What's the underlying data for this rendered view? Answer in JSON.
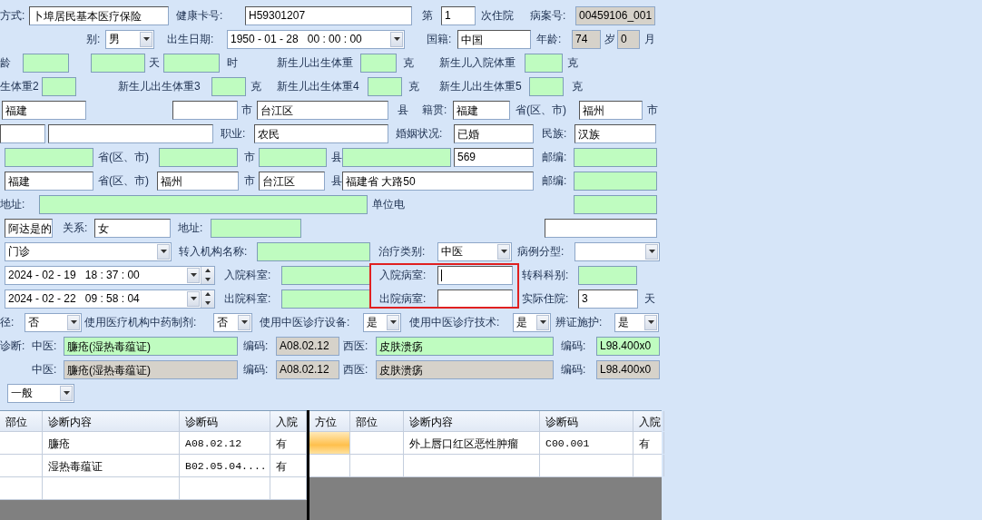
{
  "form_rows": [
    {
      "items": [
        {
          "kind": "label",
          "text": "方式:"
        },
        {
          "kind": "field",
          "value": "卜埠居民基本医疗保险",
          "required": false,
          "readonly": false
        },
        {
          "kind": "label",
          "text": "健康卡号:"
        },
        {
          "kind": "field",
          "value": "H59301207",
          "required": false,
          "readonly": false
        },
        {
          "kind": "label",
          "text": "第"
        },
        {
          "kind": "field",
          "value": "1",
          "required": false,
          "readonly": false
        },
        {
          "kind": "label",
          "text": "次住院"
        },
        {
          "kind": "label",
          "text": "病案号:"
        },
        {
          "kind": "field",
          "value": "00459106_001",
          "required": false,
          "readonly": true
        }
      ]
    },
    {
      "items": [
        {
          "kind": "label",
          "text": "别:"
        },
        {
          "kind": "select",
          "value": "男"
        },
        {
          "kind": "label",
          "text": "出生日期:"
        },
        {
          "kind": "datetime",
          "value": "1950 - 01 - 28   00 : 00 : 00"
        },
        {
          "kind": "label",
          "text": "国籍:"
        },
        {
          "kind": "field",
          "value": "中国",
          "required": false,
          "readonly": false
        },
        {
          "kind": "label",
          "text": "年龄:"
        },
        {
          "kind": "field",
          "value": "74",
          "required": false,
          "readonly": true
        },
        {
          "kind": "label",
          "text": "岁"
        },
        {
          "kind": "field",
          "value": "0",
          "required": false,
          "readonly": true
        },
        {
          "kind": "label",
          "text": "月"
        }
      ]
    },
    {
      "items": [
        {
          "kind": "label",
          "text": "龄"
        },
        {
          "kind": "field",
          "required": true,
          "readonly": false
        },
        {
          "kind": "field",
          "required": true,
          "readonly": false
        },
        {
          "kind": "label",
          "text": "天"
        },
        {
          "kind": "field",
          "required": true,
          "readonly": false
        },
        {
          "kind": "label",
          "text": "时"
        },
        {
          "kind": "label",
          "text": "新生儿出生体重"
        },
        {
          "kind": "field",
          "required": true,
          "readonly": false
        },
        {
          "kind": "label",
          "text": "克"
        },
        {
          "kind": "label",
          "text": "新生儿入院体重"
        },
        {
          "kind": "field",
          "required": true,
          "readonly": false
        },
        {
          "kind": "label",
          "text": "克"
        }
      ]
    },
    {
      "items": [
        {
          "kind": "label",
          "text": "生体重2"
        },
        {
          "kind": "field",
          "required": true,
          "readonly": false
        },
        {
          "kind": "label",
          "text": "新生儿出生体重3"
        },
        {
          "kind": "field",
          "required": true,
          "readonly": false
        },
        {
          "kind": "label",
          "text": "克"
        },
        {
          "kind": "label",
          "text": "新生儿出生体重4"
        },
        {
          "kind": "field",
          "required": true,
          "readonly": false
        },
        {
          "kind": "label",
          "text": "克"
        },
        {
          "kind": "label",
          "text": "新生儿出生体重5"
        },
        {
          "kind": "field",
          "required": true,
          "readonly": false
        },
        {
          "kind": "label",
          "text": "克"
        }
      ]
    },
    {
      "items": [
        {
          "kind": "field",
          "value": "福建",
          "required": false,
          "readonly": false
        },
        {
          "kind": "field",
          "required": false,
          "readonly": false
        },
        {
          "kind": "label",
          "text": "市"
        },
        {
          "kind": "field",
          "value": "台江区",
          "required": false,
          "readonly": false
        },
        {
          "kind": "label",
          "text": "县"
        },
        {
          "kind": "label",
          "text": "籍贯:"
        },
        {
          "kind": "field",
          "value": "福建",
          "required": false,
          "readonly": false
        },
        {
          "kind": "label",
          "text": "省(区、市)"
        },
        {
          "kind": "field",
          "value": "福州",
          "required": false,
          "readonly": false
        },
        {
          "kind": "label",
          "text": "市"
        }
      ]
    },
    {
      "items": [
        {
          "kind": "field",
          "required": false,
          "readonly": false
        },
        {
          "kind": "field",
          "required": false,
          "readonly": false
        },
        {
          "kind": "label",
          "text": "职业:"
        },
        {
          "kind": "field",
          "value": "农民",
          "required": false,
          "readonly": false
        },
        {
          "kind": "label",
          "text": "婚姻状况:"
        },
        {
          "kind": "field",
          "value": "已婚",
          "required": false,
          "readonly": false
        },
        {
          "kind": "label",
          "text": "民族:"
        },
        {
          "kind": "field",
          "value": "汉族",
          "required": false,
          "readonly": false
        }
      ]
    },
    {
      "items": [
        {
          "kind": "field",
          "required": true,
          "readonly": false
        },
        {
          "kind": "label",
          "text": "省(区、市)"
        },
        {
          "kind": "field",
          "required": true,
          "readonly": false
        },
        {
          "kind": "label",
          "text": "市"
        },
        {
          "kind": "field",
          "required": true,
          "readonly": false
        },
        {
          "kind": "label",
          "text": "县"
        },
        {
          "kind": "field",
          "required": true,
          "readonly": false
        },
        {
          "kind": "field",
          "value": "569",
          "required": false,
          "readonly": false
        },
        {
          "kind": "label",
          "text": "邮编:"
        },
        {
          "kind": "field",
          "required": true,
          "readonly": false
        }
      ]
    },
    {
      "items": [
        {
          "kind": "field",
          "value": "福建",
          "required": false,
          "readonly": false
        },
        {
          "kind": "label",
          "text": "省(区、市)"
        },
        {
          "kind": "field",
          "value": "福州",
          "required": false,
          "readonly": false
        },
        {
          "kind": "label",
          "text": "市"
        },
        {
          "kind": "field",
          "value": "台江区",
          "required": false,
          "readonly": false
        },
        {
          "kind": "label",
          "text": "县"
        },
        {
          "kind": "field",
          "value": "福建省 大路50",
          "required": false,
          "readonly": false
        },
        {
          "kind": "label",
          "text": "邮编:"
        },
        {
          "kind": "field",
          "required": true,
          "readonly": false
        }
      ]
    },
    {
      "items": [
        {
          "kind": "label",
          "text": "地址:"
        },
        {
          "kind": "field",
          "required": true,
          "readonly": false
        },
        {
          "kind": "label",
          "text": "单位电"
        },
        {
          "kind": "field",
          "required": true,
          "readonly": false
        }
      ]
    },
    {
      "items": [
        {
          "kind": "field",
          "value": "阿达是的",
          "required": false,
          "readonly": false
        },
        {
          "kind": "label",
          "text": "关系:"
        },
        {
          "kind": "field",
          "value": "女",
          "required": false,
          "readonly": false
        },
        {
          "kind": "label",
          "text": "地址:"
        },
        {
          "kind": "field",
          "required": true,
          "readonly": false
        },
        {
          "kind": "field",
          "required": false,
          "readonly": false
        }
      ]
    },
    {
      "items": [
        {
          "kind": "select",
          "value": "门诊"
        },
        {
          "kind": "label",
          "text": "转入机构名称:"
        },
        {
          "kind": "field",
          "required": true,
          "readonly": false
        },
        {
          "kind": "label",
          "text": "治疗类别:"
        },
        {
          "kind": "select",
          "value": "中医"
        },
        {
          "kind": "label",
          "text": "病例分型:"
        },
        {
          "kind": "select"
        }
      ]
    },
    {
      "items": [
        {
          "kind": "spin-datetime",
          "value": "2024 - 02 - 19   18 : 37 : 00"
        },
        {
          "kind": "label",
          "text": "入院科室:"
        },
        {
          "kind": "field",
          "required": true,
          "readonly": false
        },
        {
          "kind": "label",
          "text": "入院病室:"
        },
        {
          "kind": "field",
          "required": false,
          "readonly": false,
          "focused": true
        },
        {
          "kind": "label",
          "text": "转科科别:"
        },
        {
          "kind": "field",
          "required": true,
          "readonly": false
        }
      ]
    },
    {
      "items": [
        {
          "kind": "spin-datetime",
          "value": "2024 - 02 - 22   09 : 58 : 04"
        },
        {
          "kind": "label",
          "text": "出院科室:"
        },
        {
          "kind": "field",
          "required": true,
          "readonly": false
        },
        {
          "kind": "label",
          "text": "出院病室:"
        },
        {
          "kind": "field",
          "required": false,
          "readonly": false
        },
        {
          "kind": "label",
          "text": "实际住院:"
        },
        {
          "kind": "field",
          "value": "3",
          "required": false,
          "readonly": false
        },
        {
          "kind": "label",
          "text": "天"
        }
      ]
    },
    {
      "items": [
        {
          "kind": "label",
          "text": "径:"
        },
        {
          "kind": "select",
          "value": "否"
        },
        {
          "kind": "label",
          "text": "使用医疗机构中药制剂:"
        },
        {
          "kind": "select",
          "value": "否"
        },
        {
          "kind": "label",
          "text": "使用中医诊疗设备:"
        },
        {
          "kind": "select",
          "value": "是"
        },
        {
          "kind": "label",
          "text": "使用中医诊疗技术:"
        },
        {
          "kind": "select",
          "value": "是"
        },
        {
          "kind": "label",
          "text": "辨证施护:"
        },
        {
          "kind": "select",
          "value": "是"
        }
      ]
    },
    {
      "items": [
        {
          "kind": "label",
          "text": "诊断:"
        },
        {
          "kind": "label",
          "text": "中医:"
        },
        {
          "kind": "field",
          "value": "臁疮(湿热毒蕴证)",
          "required": true,
          "readonly": false
        },
        {
          "kind": "label",
          "text": "编码:"
        },
        {
          "kind": "field",
          "value": "A08.02.12",
          "required": false,
          "readonly": true
        },
        {
          "kind": "label",
          "text": "西医:"
        },
        {
          "kind": "field",
          "value": "皮肤溃疡",
          "required": true,
          "readonly": false
        },
        {
          "kind": "label",
          "text": "编码:"
        },
        {
          "kind": "field",
          "value": "L98.400x0",
          "required": true,
          "readonly": false
        }
      ]
    },
    {
      "items": [
        {
          "kind": "label",
          "text": "中医:"
        },
        {
          "kind": "field",
          "value": "臁疮(湿热毒蕴证)",
          "required": false,
          "readonly": true
        },
        {
          "kind": "label",
          "text": "编码:"
        },
        {
          "kind": "field",
          "value": "A08.02.12",
          "required": false,
          "readonly": true
        },
        {
          "kind": "label",
          "text": "西医:"
        },
        {
          "kind": "field",
          "value": "皮肤溃疡",
          "required": false,
          "readonly": true
        },
        {
          "kind": "label",
          "text": "编码:"
        },
        {
          "kind": "field",
          "value": "L98.400x0",
          "required": false,
          "readonly": true
        }
      ]
    },
    {
      "items": [
        {
          "kind": "select",
          "value": "一般"
        }
      ]
    }
  ],
  "tables": [
    {
      "columns": [
        "部位",
        "诊断内容",
        "诊断码",
        "入院"
      ],
      "rows": [
        {
          "selected": false,
          "cells": [
            null,
            "臁疮",
            "A08.02.12",
            "有"
          ]
        },
        {
          "selected": false,
          "cells": [
            null,
            "湿热毒蕴证",
            "B02.05.04....",
            "有"
          ]
        }
      ]
    },
    {
      "columns": [
        "方位",
        "部位",
        "诊断内容",
        "诊断码",
        "入院"
      ],
      "rows": [
        {
          "selected": true,
          "cells": [
            null,
            null,
            "外上唇口红区恶性肿瘤",
            "C00.001",
            "有"
          ]
        }
      ]
    }
  ]
}
